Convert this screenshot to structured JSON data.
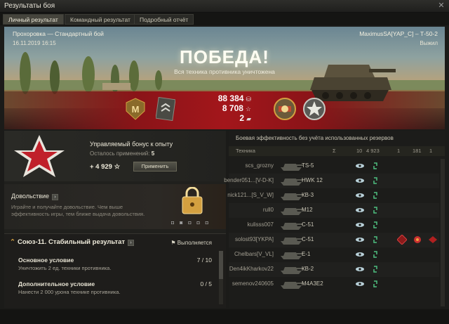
{
  "window": {
    "title": "Результаты боя"
  },
  "tabs": [
    {
      "label": "Личный результат",
      "active": true
    },
    {
      "label": "Командный результат",
      "active": false
    },
    {
      "label": "Подробный отчёт",
      "active": false
    }
  ],
  "banner": {
    "map_mode": "Прохоровка — Стандартный бой",
    "datetime": "16.11.2019 16:15",
    "player_tank": "MaximusSA[YAP_C] – Т-50-2",
    "survival": "Выжил",
    "result": "ПОБЕДА!",
    "result_subtitle": "Вся техника противника уничтожена",
    "credits": "88 384",
    "xp": "8 708",
    "crystals": "2",
    "colors": {
      "banner_red": "#a3161b",
      "accent_gold": "#d4a040"
    }
  },
  "bonus": {
    "title": "Управляемый бонус к опыту",
    "remaining_label": "Осталось применений:",
    "remaining_value": "5",
    "xp_value": "+ 4 929",
    "apply_label": "Применить"
  },
  "content": {
    "title": "Довольствие",
    "description": "Играйте и получайте довольствие. Чем выше эффективность игры, тем ближе выдача довольствия."
  },
  "mission": {
    "title": "Союз-11. Стабильный результат",
    "status": "Выполняется",
    "condition1_title": "Основное условие",
    "condition1_desc": "Уничтожить 2 ед. техники противника.",
    "condition1_progress": "7 / 10",
    "condition2_title": "Дополнительное условие",
    "condition2_desc": "Нанести 2 000 урона технике противника.",
    "condition2_progress": "0 / 5"
  },
  "efficiency": {
    "title": "Боевая эффективность без учёта использованных резервов",
    "header": {
      "col_vehicle": "Техника",
      "col_a": "Σ",
      "col_b": "10",
      "col_c": "4 923",
      "col_d": "1",
      "col_e": "181",
      "col_f": "1"
    },
    "rows": [
      {
        "player": "scs_grozny",
        "tank": "TS-5"
      },
      {
        "player": "bender051...[V-D-K]",
        "tank": "HWK 12"
      },
      {
        "player": "nick121...[S_V_W]",
        "tank": "КВ-3"
      },
      {
        "player": "rull0",
        "tank": "M12"
      },
      {
        "player": "kulisss007",
        "tank": "С-51"
      },
      {
        "player": "solost93[YKPA]",
        "tank": "С-51"
      },
      {
        "player": "Chelbars[V_VL]",
        "tank": "Е-1"
      },
      {
        "player": "Den4ikKharkov22",
        "tank": "КВ-2"
      },
      {
        "player": "semenov240605",
        "tank": "M4A3E2"
      }
    ]
  }
}
